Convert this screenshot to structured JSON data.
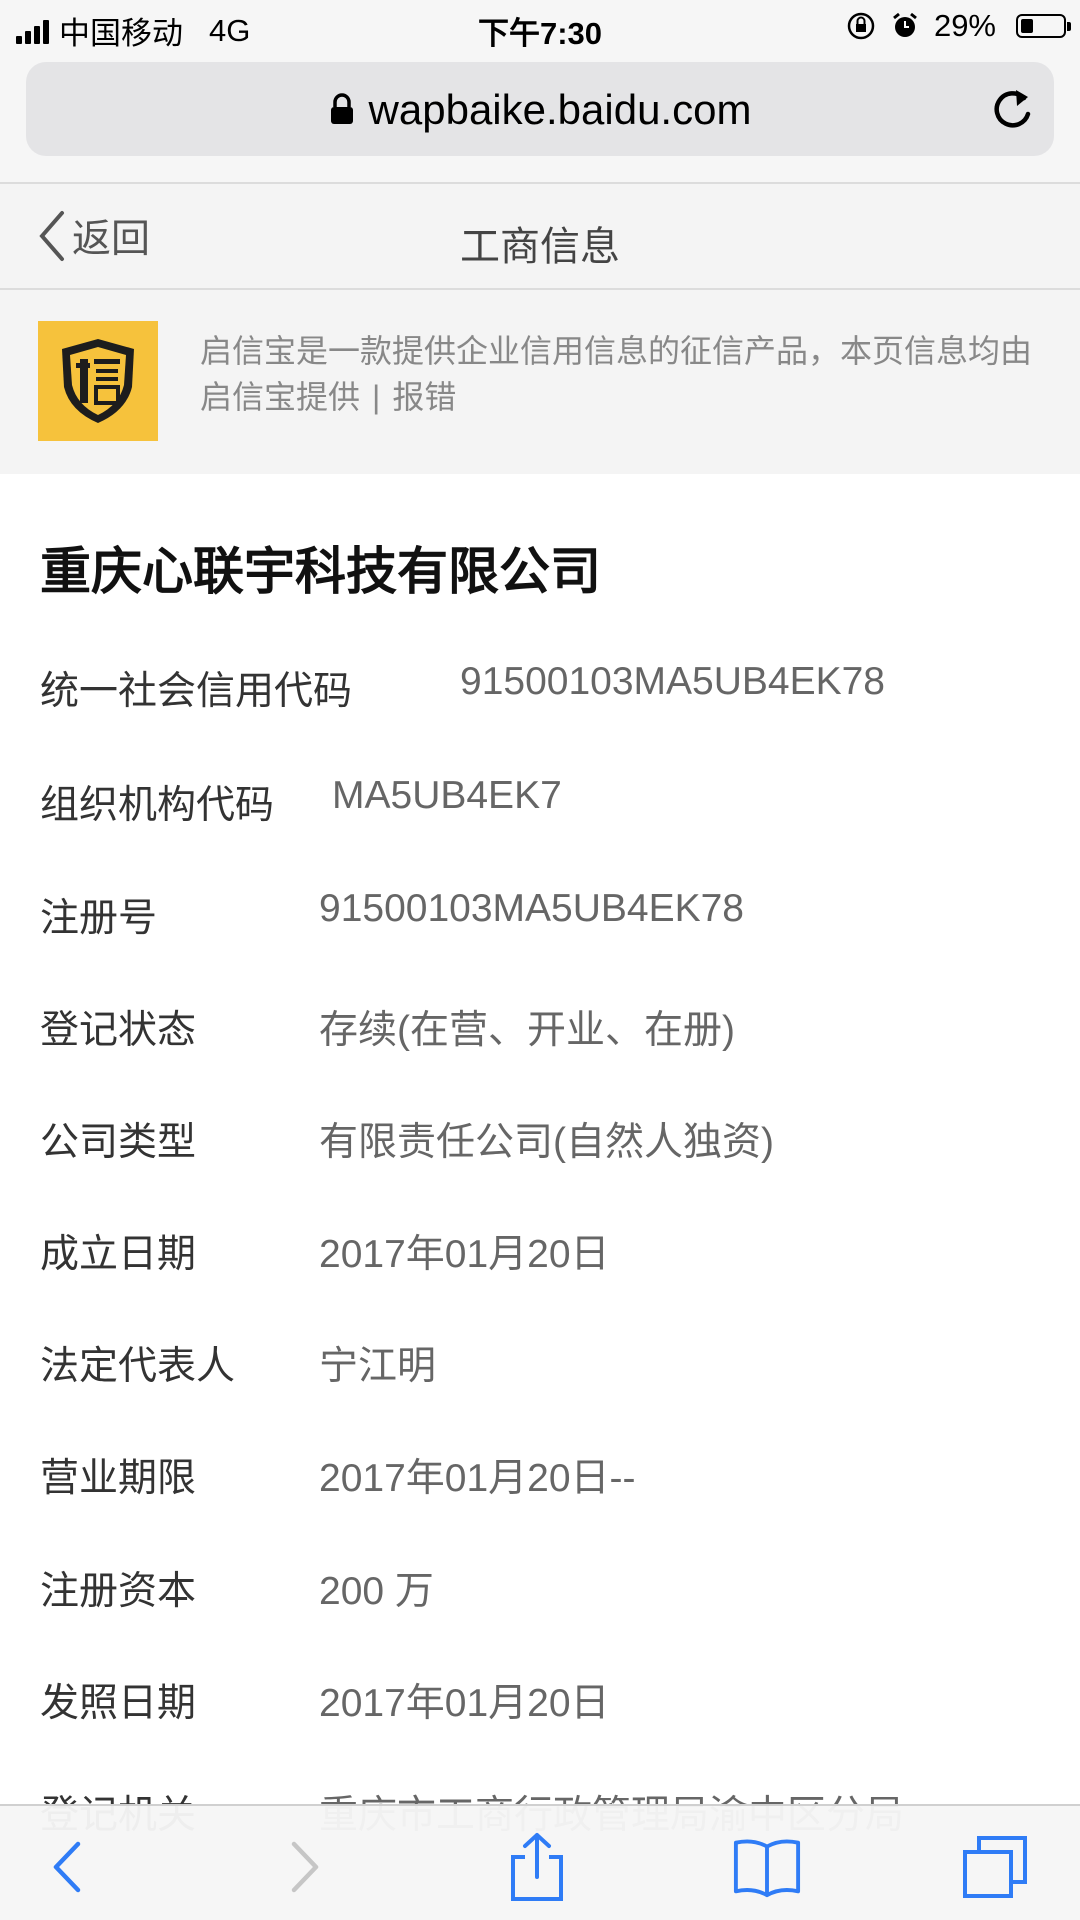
{
  "status_bar": {
    "carrier": "中国移动",
    "network": "4G",
    "time": "下午7:30",
    "battery_percent": "29%",
    "battery_level": 0.29
  },
  "browser": {
    "url": "wapbaike.baidu.com"
  },
  "nav": {
    "back_label": "返回",
    "title": "工商信息"
  },
  "banner": {
    "text": "启信宝是一款提供企业信用信息的征信产品，本页信息均由启信宝提供",
    "separator": "|",
    "report_label": "报错"
  },
  "company": {
    "name": "重庆心联宇科技有限公司"
  },
  "info_rows": [
    {
      "label": "统一社会信用代码",
      "value": "91500103MA5UB4EK78"
    },
    {
      "label": "组织机构代码",
      "value": "MA5UB4EK7"
    },
    {
      "label": "注册号",
      "value": "91500103MA5UB4EK78"
    },
    {
      "label": "登记状态",
      "value": "存续(在营、开业、在册)"
    },
    {
      "label": "公司类型",
      "value": "有限责任公司(自然人独资)"
    },
    {
      "label": "成立日期",
      "value": "2017年01月20日"
    },
    {
      "label": "法定代表人",
      "value": "宁江明"
    },
    {
      "label": "营业期限",
      "value": "2017年01月20日--"
    },
    {
      "label": "注册资本",
      "value": "200 万"
    },
    {
      "label": "发照日期",
      "value": "2017年01月20日"
    },
    {
      "label": "登记机关",
      "value": "重庆市工商行政管理局渝中区分局"
    }
  ],
  "toolbar": {
    "items": [
      "back-icon",
      "forward-icon",
      "share-icon",
      "bookmarks-icon",
      "tabs-icon"
    ]
  },
  "colors": {
    "accent": "#2f7cf6",
    "logo_bg": "#f6c23c"
  }
}
